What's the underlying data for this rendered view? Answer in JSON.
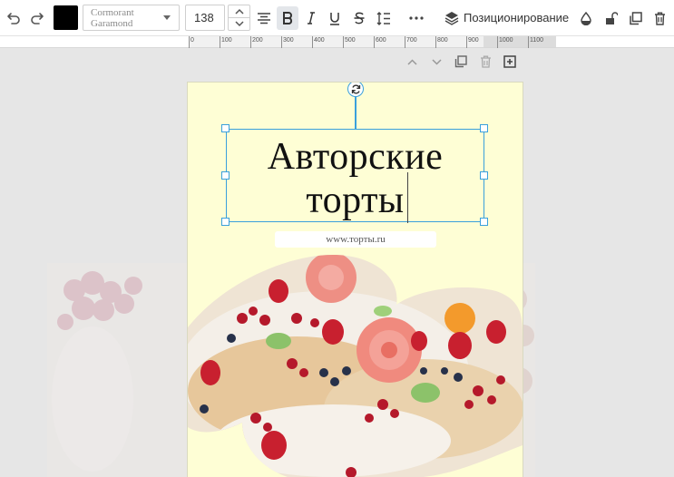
{
  "toolbar": {
    "text_color": "#000000",
    "font_family": "Cormorant Garamond",
    "font_size": "138",
    "positioning_label": "Позиционирование"
  },
  "ruler": {
    "labels": [
      "0",
      "100",
      "200",
      "300",
      "400",
      "500",
      "600",
      "700",
      "800",
      "900",
      "1000",
      "1100"
    ]
  },
  "page": {
    "title": "Авторские торты",
    "url": "www.торты.ru",
    "background_color": "#fefed5"
  },
  "colors": {
    "accent": "#3aa0dc"
  }
}
